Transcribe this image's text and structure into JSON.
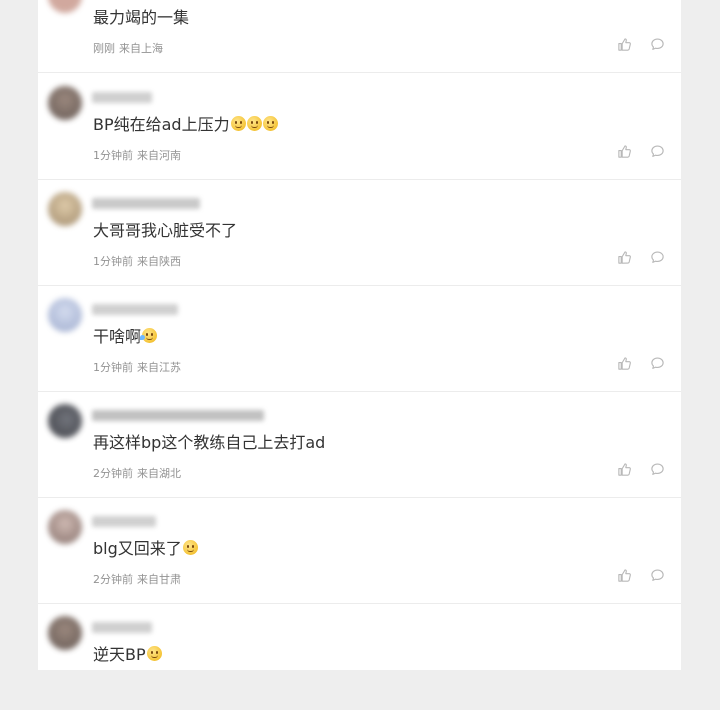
{
  "comments": [
    {
      "text": "最力竭的一集",
      "emojis": [],
      "time": "刚刚",
      "location": "来自上海",
      "avatar_color": "#c99a8e",
      "username_color": "#d9b3b3"
    },
    {
      "text": "BP纯在给ad上压力",
      "emojis": [
        "smile-emoji",
        "smile-emoji",
        "smile-emoji"
      ],
      "time": "1分钟前",
      "location": "来自河南",
      "avatar_color": "#6b5a52",
      "username_color": "#a8a8a8"
    },
    {
      "text": "大哥哥我心脏受不了",
      "emojis": [],
      "time": "1分钟前",
      "location": "来自陕西",
      "avatar_color": "#b59a72",
      "username_color": "#9d9d9d"
    },
    {
      "text": "干啥啊",
      "emojis": [
        "laugh-cry-emoji"
      ],
      "time": "1分钟前",
      "location": "来自江苏",
      "avatar_color": "#a8b6d3",
      "username_color": "#a9a9a9"
    },
    {
      "text": "再这样bp这个教练自己上去打ad",
      "emojis": [],
      "time": "2分钟前",
      "location": "来自湖北",
      "avatar_color": "#3d3f46",
      "username_color": "#8e8e8e"
    },
    {
      "text": "blg又回来了",
      "emojis": [
        "smile-emoji"
      ],
      "time": "2分钟前",
      "location": "来自甘肃",
      "avatar_color": "#9b8078",
      "username_color": "#a9a9a9"
    },
    {
      "text": "逆天BP",
      "emojis": [
        "smile-emoji"
      ],
      "time": "",
      "location": "",
      "avatar_color": "#6b5a52",
      "username_color": "#a8a8a8"
    }
  ],
  "icons": {
    "like": "thumbs-up-icon",
    "reply": "comment-bubble-icon"
  },
  "colors": {
    "meta": "#939393",
    "text": "#333333",
    "icon": "#b8b8b8"
  }
}
